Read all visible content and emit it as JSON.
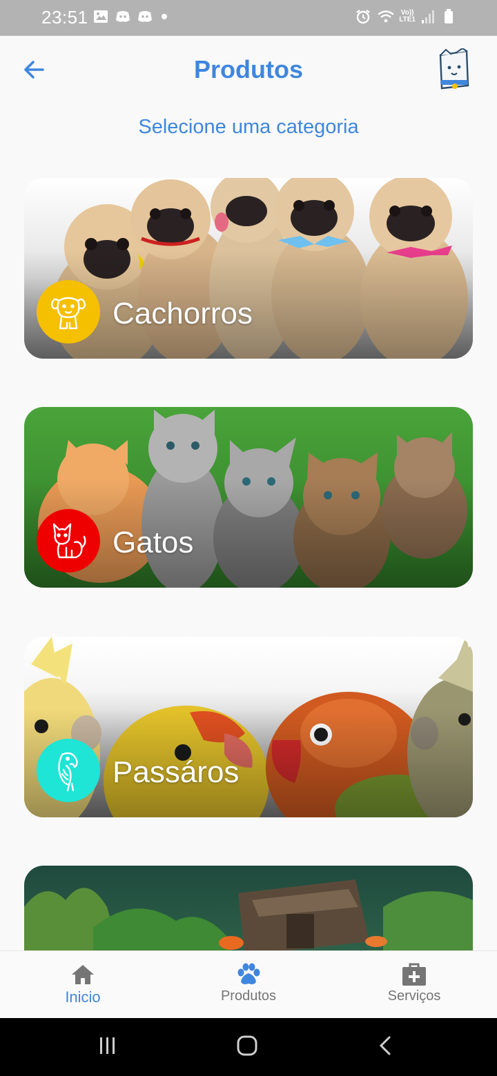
{
  "status_bar": {
    "time": "23:51",
    "left_icons": [
      "image-icon",
      "discord-icon",
      "discord-icon"
    ],
    "network_label_top": "Vo))",
    "network_label_bottom": "LTE1"
  },
  "header": {
    "title": "Produtos",
    "back_icon": "arrow-left-icon",
    "logo_icon": "pet-shop-logo-icon"
  },
  "subtitle": "Selecione uma categoria",
  "categories": [
    {
      "label": "Cachorros",
      "icon": "dog-icon",
      "color": "#f5c000"
    },
    {
      "label": "Gatos",
      "icon": "cat-icon",
      "color": "#ee0000"
    },
    {
      "label": "Passáros",
      "icon": "parrot-icon",
      "color": "#1ee5d6"
    },
    {
      "label": "",
      "icon": "",
      "color": ""
    }
  ],
  "bottom_nav": {
    "items": [
      {
        "label": "Inicio",
        "icon": "home-icon",
        "active": true
      },
      {
        "label": "Produtos",
        "icon": "paw-icon",
        "active": false
      },
      {
        "label": "Serviços",
        "icon": "medical-kit-icon",
        "active": false
      }
    ]
  },
  "colors": {
    "accent": "#3f86de",
    "status_bar": "#b3b3b3",
    "nav_inactive": "#757575"
  }
}
